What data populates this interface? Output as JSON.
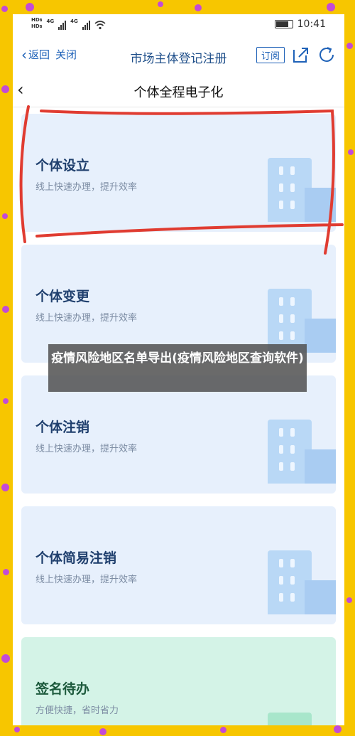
{
  "status_bar": {
    "left_labels": [
      "HD",
      "B",
      "HD",
      "B",
      "4G",
      "4G"
    ],
    "time": "10:41"
  },
  "top_nav": {
    "back_label": "返回",
    "close_label": "关闭",
    "title": "市场主体登记注册",
    "subscribe_label": "订阅"
  },
  "page": {
    "title": "个体全程电子化"
  },
  "cards": [
    {
      "title": "个体设立",
      "subtitle": "线上快速办理，提升效率"
    },
    {
      "title": "个体变更",
      "subtitle": "线上快速办理，提升效率"
    },
    {
      "title": "个体注销",
      "subtitle": "线上快速办理，提升效率"
    },
    {
      "title": "个体简易注销",
      "subtitle": "线上快速办理，提升效率"
    },
    {
      "title": "签名待办",
      "subtitle": "方便快捷，省时省力"
    }
  ],
  "overlay_caption": "疫情风险地区名单导出(疫情风险地区查询软件)",
  "colors": {
    "frame": "#f7c600",
    "dots": "#c34bd6",
    "nav_blue": "#1f62b8",
    "annotation_red": "#e03c31"
  }
}
